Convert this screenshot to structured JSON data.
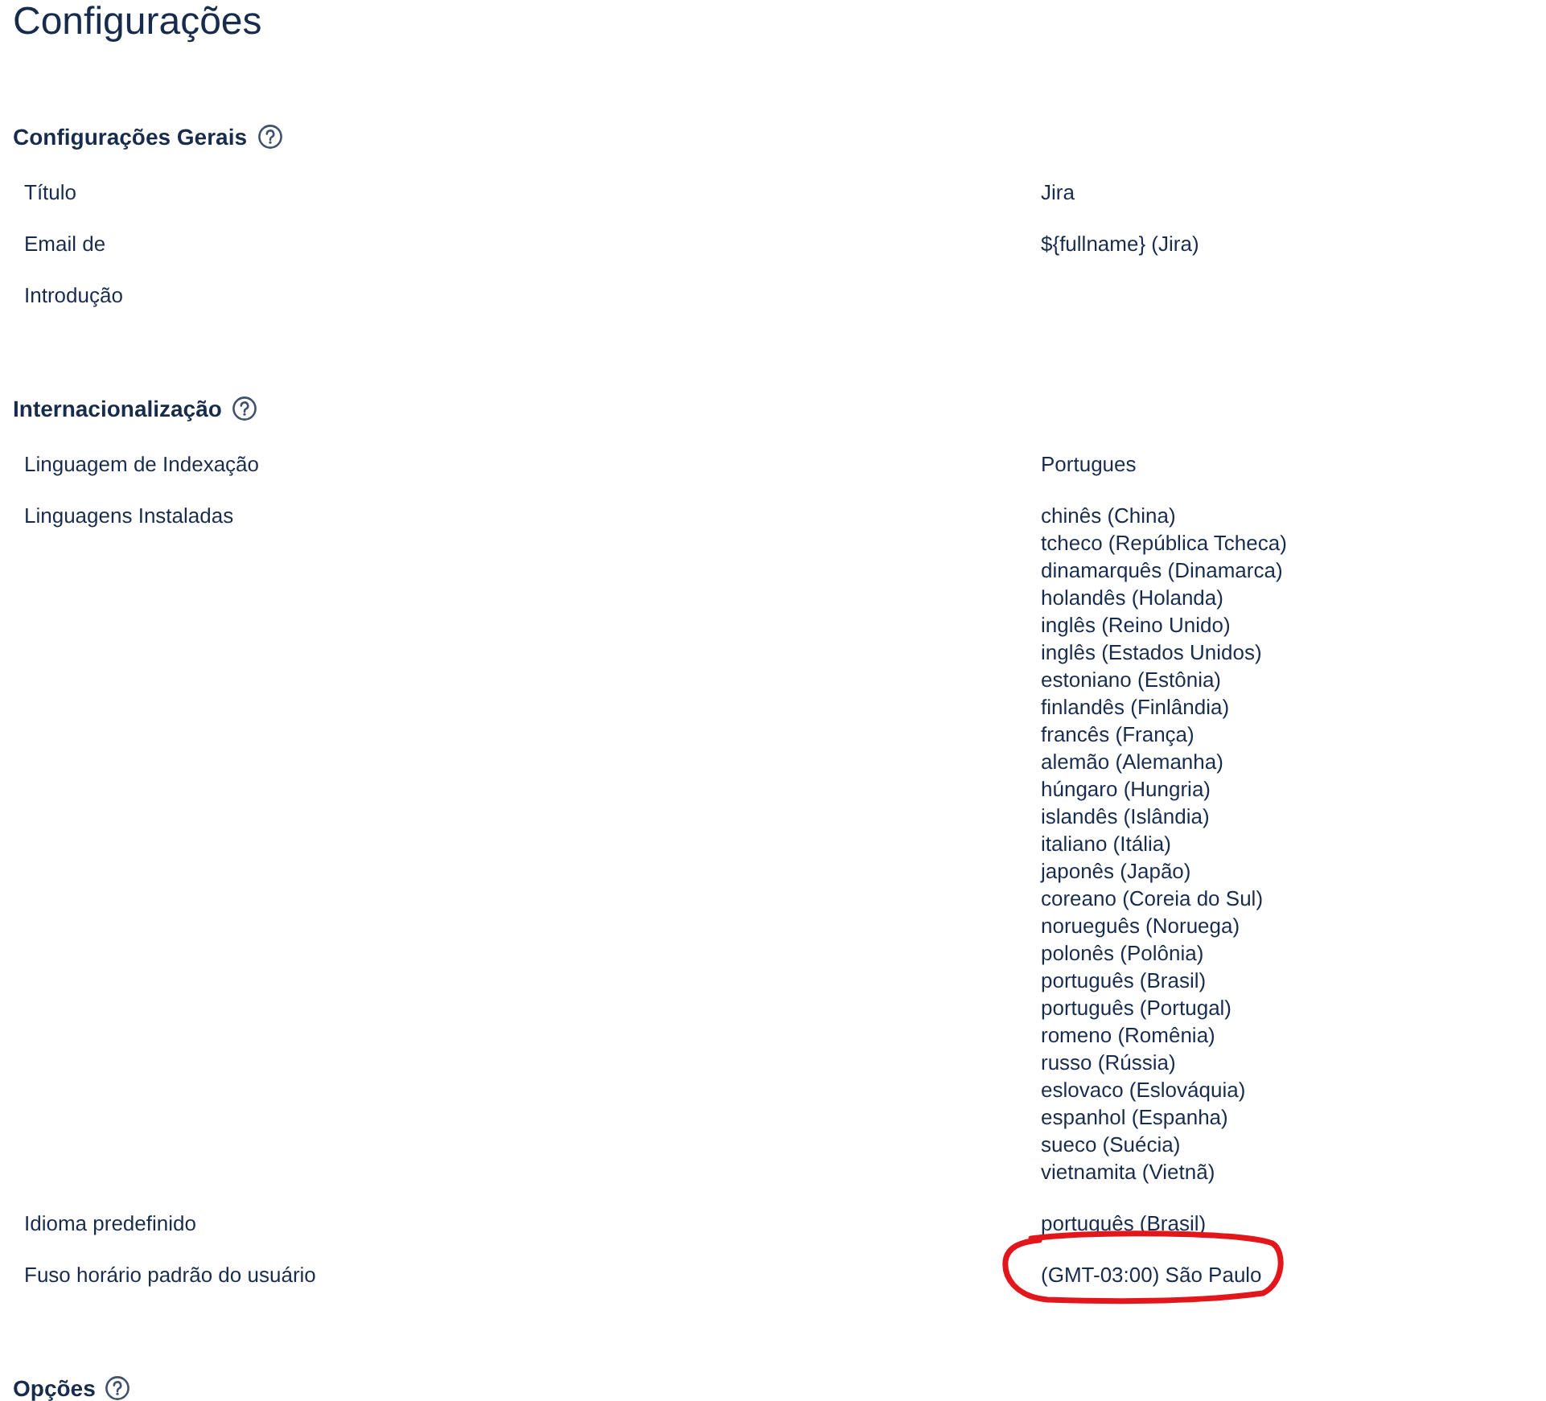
{
  "page_title": "Configurações",
  "sections": [
    {
      "title": "Configurações Gerais",
      "rows": [
        {
          "label": "Título",
          "values": [
            "Jira"
          ],
          "highlighted": false
        },
        {
          "label": "Email de",
          "values": [
            "${fullname} (Jira)"
          ],
          "highlighted": false
        },
        {
          "label": "Introdução",
          "highlighted": false
        }
      ]
    },
    {
      "title": "Internacionalização",
      "rows": [
        {
          "label": "Linguagem de Indexação",
          "values": [
            "Portugues"
          ],
          "highlighted": false
        },
        {
          "label": "Linguagens Instaladas",
          "values": [
            "chinês (China)",
            "tcheco (República Tcheca)",
            "dinamarquês (Dinamarca)",
            "holandês (Holanda)",
            "inglês (Reino Unido)",
            "inglês (Estados Unidos)",
            "estoniano (Estônia)",
            "finlandês (Finlândia)",
            "francês (França)",
            "alemão (Alemanha)",
            "húngaro (Hungria)",
            "islandês (Islândia)",
            "italiano (Itália)",
            "japonês (Japão)",
            "coreano (Coreia do Sul)",
            "norueguês (Noruega)",
            "polonês (Polônia)",
            "português (Brasil)",
            "português (Portugal)",
            "romeno (Romênia)",
            "russo (Rússia)",
            "eslovaco (Eslováquia)",
            "espanhol (Espanha)",
            "sueco (Suécia)",
            "vietnamita (Vietnã)"
          ],
          "highlighted": false
        },
        {
          "label": "Idioma predefinido",
          "values": [
            "português (Brasil)"
          ],
          "highlighted": false
        },
        {
          "label": "Fuso horário padrão do usuário",
          "values": [
            "(GMT-03:00) São Paulo"
          ],
          "highlighted": true
        }
      ]
    },
    {
      "title": "Opções"
    }
  ]
}
